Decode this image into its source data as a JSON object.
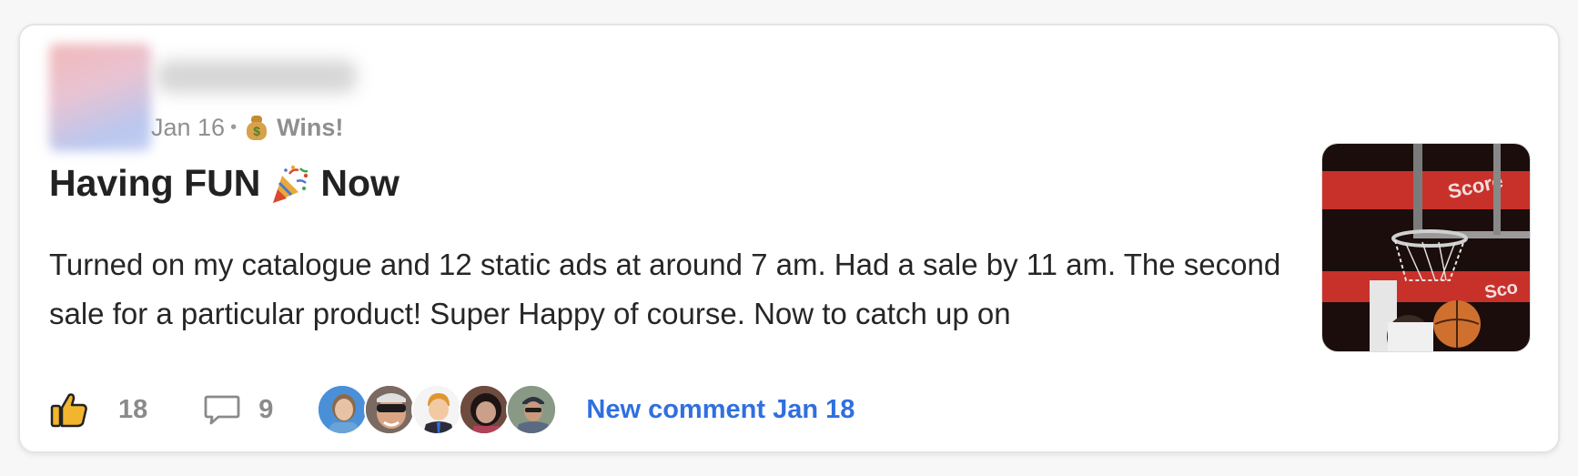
{
  "post": {
    "author_avatar_alt": "",
    "date": "Jan 16",
    "separator": "•",
    "category_icon": "money-bag-icon",
    "category": "Wins!",
    "title_part1": "Having FUN",
    "title_icon": "party-popper-icon",
    "title_part2": "Now",
    "body": "Turned on my catalogue and 12 static ads at around 7 am. Had a sale by 11 am. The second sale for a particular product! Super Happy of course. Now to catch up on",
    "thumbnail": "basketball-dunk-image",
    "thumbnail_text_top": "Score",
    "thumbnail_text_bottom": "Sco"
  },
  "footer": {
    "like_icon": "thumbs-up-icon",
    "like_count": "18",
    "comment_icon": "comment-bubble-icon",
    "comment_count": "9",
    "commenter_count": 5,
    "new_comment_label": "New comment Jan 18"
  },
  "colors": {
    "accent": "#2f6fe0",
    "muted": "#8a8a8a",
    "text": "#262626",
    "title": "#222222"
  }
}
